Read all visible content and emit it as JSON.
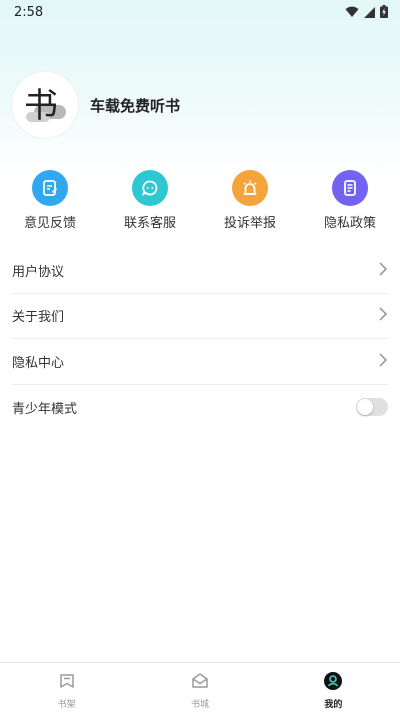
{
  "status_bar": {
    "time": "2:58",
    "icons": [
      "wifi-icon",
      "signal-icon",
      "battery-charging-icon"
    ]
  },
  "profile": {
    "avatar_glyph": "书",
    "app_name": "车载免费听书"
  },
  "shortcuts": [
    {
      "label": "意见反馈",
      "icon": "feedback-icon",
      "color": "#2fa8f0"
    },
    {
      "label": "联系客服",
      "icon": "chat-icon",
      "color": "#2fc8d2"
    },
    {
      "label": "投诉举报",
      "icon": "alarm-icon",
      "color": "#f5a43a"
    },
    {
      "label": "隐私政策",
      "icon": "policy-doc-icon",
      "color": "#7263f0"
    }
  ],
  "menu": [
    {
      "label": "用户协议",
      "control": "chevron"
    },
    {
      "label": "关于我们",
      "control": "chevron"
    },
    {
      "label": "隐私中心",
      "control": "chevron"
    },
    {
      "label": "青少年模式",
      "control": "toggle",
      "enabled": false
    }
  ],
  "tabbar": {
    "tabs": [
      {
        "label": "书架",
        "icon": "bookshelf-icon",
        "active": false
      },
      {
        "label": "书城",
        "icon": "bookstore-icon",
        "active": false
      },
      {
        "label": "我的",
        "icon": "profile-icon",
        "active": true
      }
    ]
  }
}
